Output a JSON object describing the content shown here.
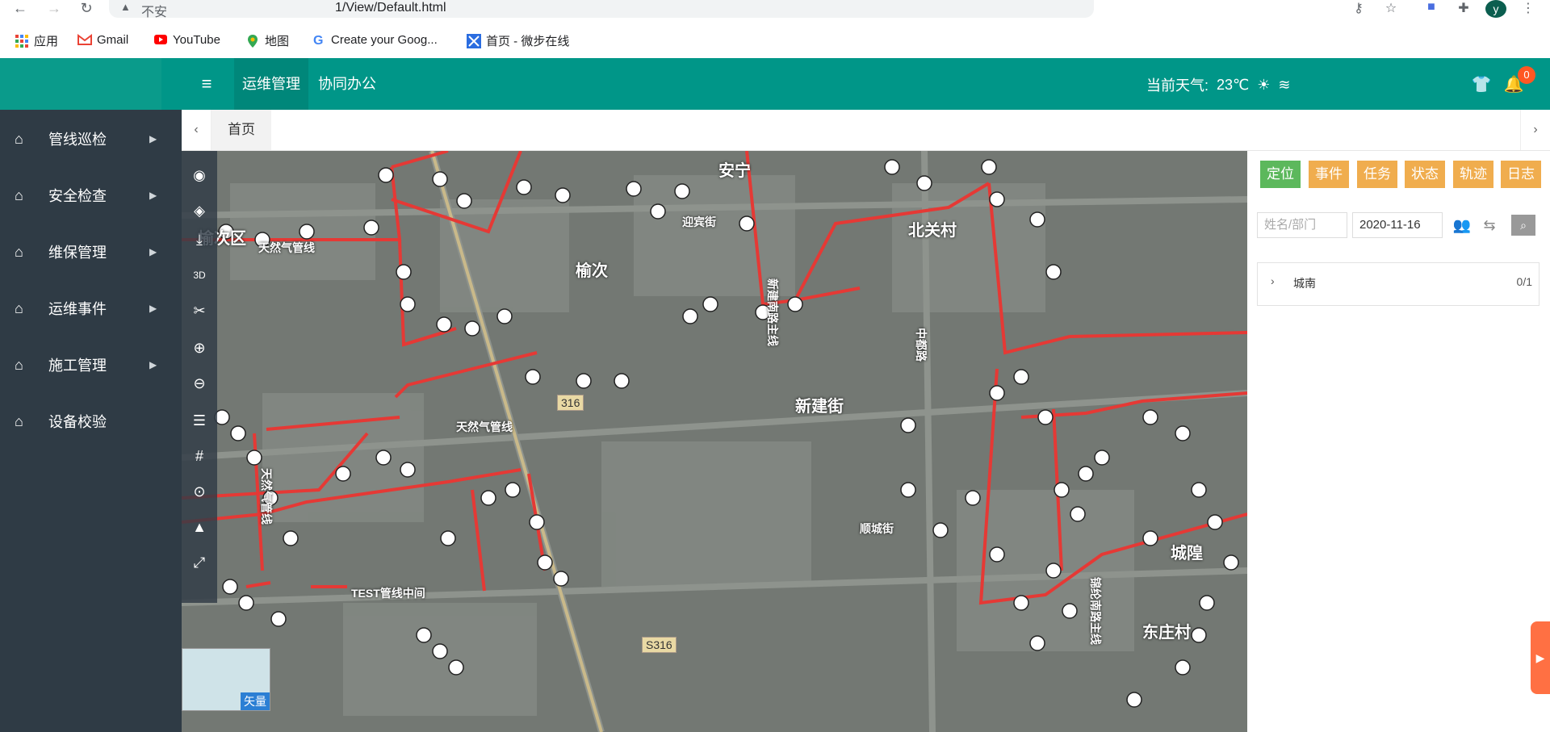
{
  "browser": {
    "security_text": "不安",
    "url": "1/View/Default.html",
    "profile_initial": "y",
    "bookmarks": [
      {
        "label": "应用",
        "icon": "apps-grid-icon"
      },
      {
        "label": "Gmail",
        "icon": "gmail-icon"
      },
      {
        "label": "YouTube",
        "icon": "youtube-icon"
      },
      {
        "label": "地图",
        "icon": "maps-pin-icon"
      },
      {
        "label": "Create your Goog...",
        "icon": "google-g-icon"
      },
      {
        "label": "首页 - 微步在线",
        "icon": "threatbook-icon"
      }
    ]
  },
  "header": {
    "nav": [
      "运维管理",
      "协同办公"
    ],
    "weather_label": "当前天气:",
    "temperature": "23℃",
    "notification_count": "0",
    "colors": {
      "primary": "#009688",
      "sidebar": "#2f3b45",
      "route": "#e53935"
    }
  },
  "sidebar": {
    "items": [
      {
        "label": "管线巡检",
        "has_arrow": true
      },
      {
        "label": "安全检查",
        "has_arrow": true
      },
      {
        "label": "维保管理",
        "has_arrow": true
      },
      {
        "label": "运维事件",
        "has_arrow": true
      },
      {
        "label": "施工管理",
        "has_arrow": true
      },
      {
        "label": "设备校验",
        "has_arrow": false
      }
    ]
  },
  "tabs": {
    "home": "首页"
  },
  "map": {
    "labels": [
      {
        "text": "榆次区"
      },
      {
        "text": "天然气管线"
      },
      {
        "text": "榆次"
      },
      {
        "text": "迎宾街"
      },
      {
        "text": "安宁"
      },
      {
        "text": "北关村"
      },
      {
        "text": "新建街"
      },
      {
        "text": "天然气管线"
      },
      {
        "text": "S316"
      },
      {
        "text": "天然气管线"
      },
      {
        "text": "TEST管线中间"
      },
      {
        "text": "城隍"
      },
      {
        "text": "东庄村"
      },
      {
        "text": "新建南路主线"
      },
      {
        "text": "锦纶南路主线"
      },
      {
        "text": "中都路"
      },
      {
        "text": "顺城街"
      }
    ],
    "minimap_label": "矢量",
    "road_badges": [
      "S316",
      "316"
    ]
  },
  "panel": {
    "buttons": [
      "定位",
      "事件",
      "任务",
      "状态",
      "轨迹",
      "日志"
    ],
    "name_placeholder": "姓名/部门",
    "date": "2020-11-16",
    "tree": [
      {
        "name": "城南",
        "count": "0/1"
      }
    ]
  }
}
